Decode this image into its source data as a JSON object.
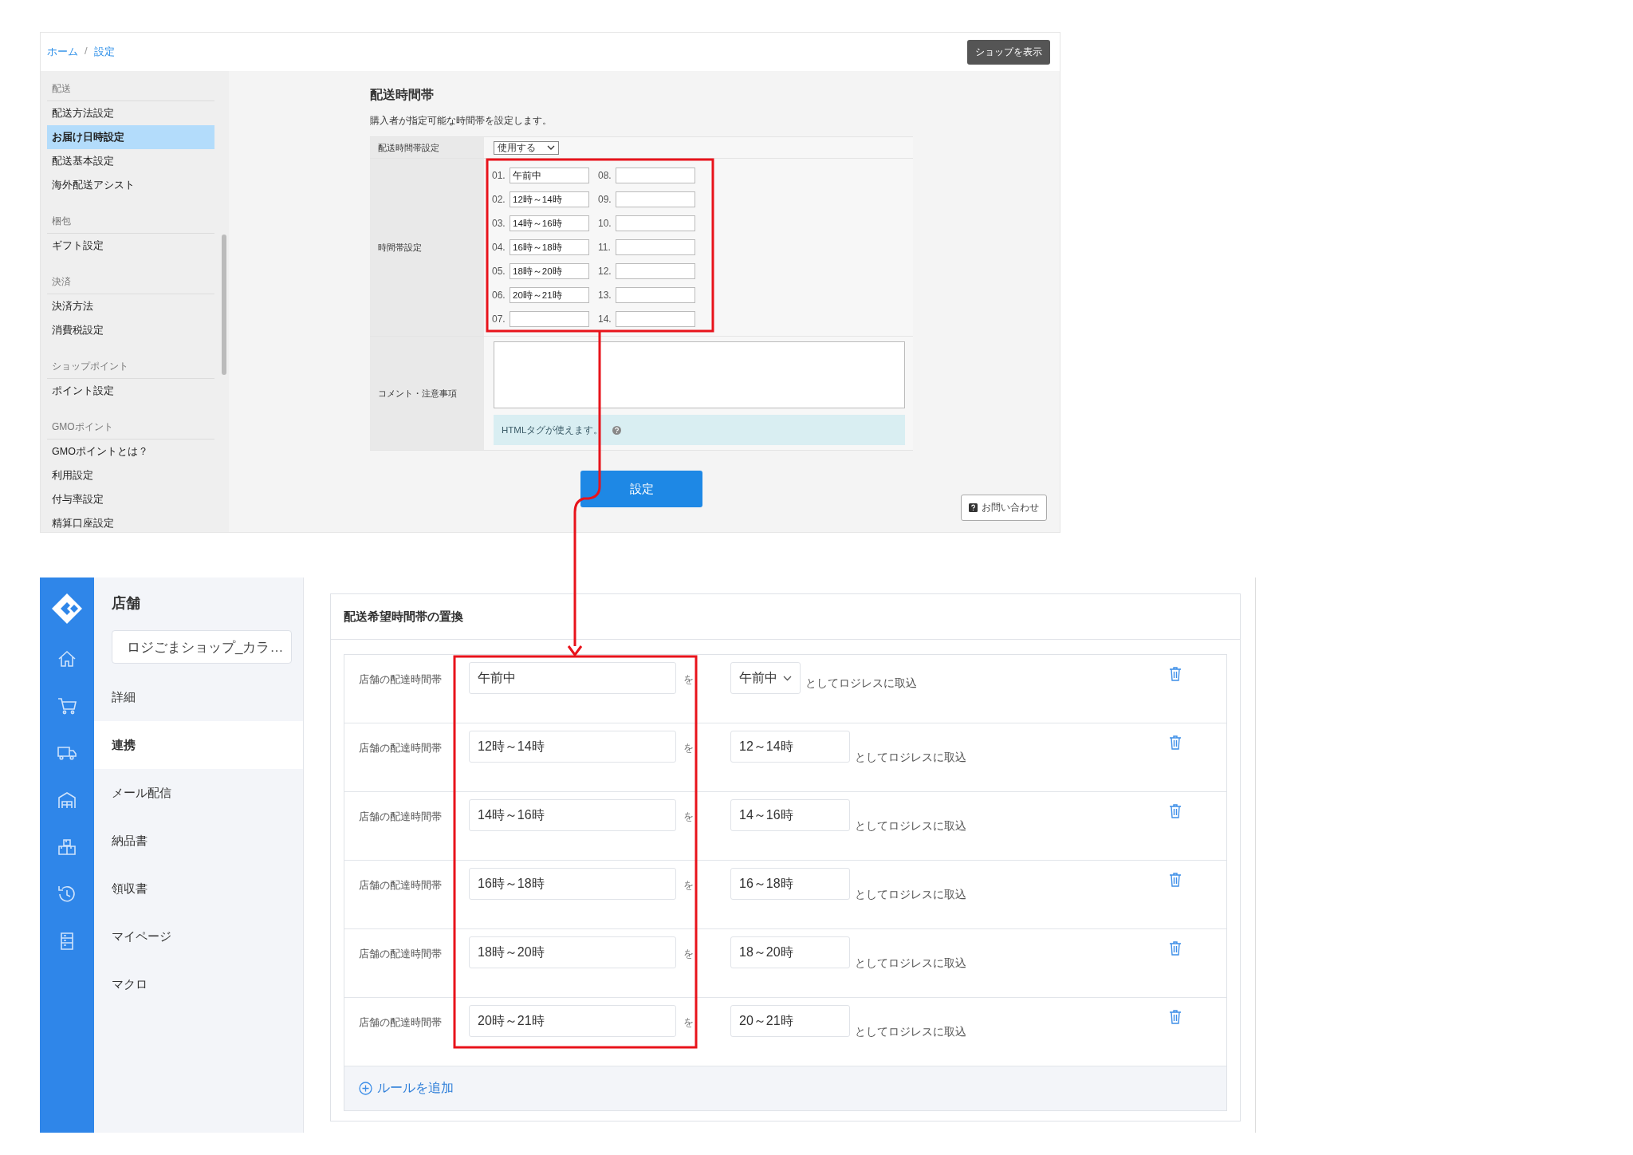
{
  "top_screen": {
    "breadcrumb": [
      "ホーム",
      "設定"
    ],
    "breadcrumb_separator": "/",
    "view_shop_button": "ショップを表示",
    "sidebar": [
      {
        "heading": "配送",
        "items": [
          {
            "label": "配送方法設定",
            "selected": false
          },
          {
            "label": "お届け日時設定",
            "selected": true
          },
          {
            "label": "配送基本設定",
            "selected": false
          },
          {
            "label": "海外配送アシスト",
            "selected": false
          }
        ]
      },
      {
        "heading": "梱包",
        "items": [
          {
            "label": "ギフト設定",
            "selected": false
          }
        ]
      },
      {
        "heading": "決済",
        "items": [
          {
            "label": "決済方法",
            "selected": false
          },
          {
            "label": "消費税設定",
            "selected": false
          }
        ]
      },
      {
        "heading": "ショップポイント",
        "items": [
          {
            "label": "ポイント設定",
            "selected": false
          }
        ]
      },
      {
        "heading": "GMOポイント",
        "items": [
          {
            "label": "GMOポイントとは？",
            "selected": false
          },
          {
            "label": "利用設定",
            "selected": false
          },
          {
            "label": "付与率設定",
            "selected": false
          },
          {
            "label": "精算口座設定",
            "selected": false
          }
        ]
      }
    ],
    "page_title": "配送時間帯",
    "description": "購入者が指定可能な時間帯を設定します。",
    "usage": {
      "label": "配送時間帯設定",
      "value": "使用する"
    },
    "time_slots": {
      "label": "時間帯設定",
      "slots": [
        {
          "number": "01.",
          "value": "午前中"
        },
        {
          "number": "02.",
          "value": "12時～14時"
        },
        {
          "number": "03.",
          "value": "14時～16時"
        },
        {
          "number": "04.",
          "value": "16時～18時"
        },
        {
          "number": "05.",
          "value": "18時～20時"
        },
        {
          "number": "06.",
          "value": "20時～21時"
        },
        {
          "number": "07."
        },
        {
          "number": "08."
        },
        {
          "number": "09."
        },
        {
          "number": "10."
        },
        {
          "number": "11."
        },
        {
          "number": "12."
        },
        {
          "number": "13."
        },
        {
          "number": "14."
        }
      ]
    },
    "comment": {
      "label": "コメント・注意事項",
      "hint": "HTMLタグが使えます。"
    },
    "submit_button": "設定",
    "contact_button": "お問い合わせ"
  },
  "bottom_screen": {
    "store_title": "店舗",
    "store_select": "ロジごまショップ_カラ…",
    "menu": [
      {
        "label": "詳細",
        "selected": false
      },
      {
        "label": "連携",
        "selected": true
      },
      {
        "label": "メール配信",
        "selected": false
      },
      {
        "label": "納品書",
        "selected": false
      },
      {
        "label": "領収書",
        "selected": false
      },
      {
        "label": "マイページ",
        "selected": false
      },
      {
        "label": "マクロ",
        "selected": false
      }
    ],
    "card_title": "配送希望時間帯の置換",
    "rules": [
      {
        "label": "店舗の配達時間帯",
        "source": "午前中",
        "particle": "を",
        "kind": "select",
        "target": "午前中",
        "suffix": "としてロジレスに取込"
      },
      {
        "label": "店舗の配達時間帯",
        "source": "12時～14時",
        "particle": "を",
        "kind": "input",
        "target": "12～14時",
        "suffix": "としてロジレスに取込"
      },
      {
        "label": "店舗の配達時間帯",
        "source": "14時～16時",
        "particle": "を",
        "kind": "input",
        "target": "14～16時",
        "suffix": "としてロジレスに取込"
      },
      {
        "label": "店舗の配達時間帯",
        "source": "16時～18時",
        "particle": "を",
        "kind": "input",
        "target": "16～18時",
        "suffix": "としてロジレスに取込"
      },
      {
        "label": "店舗の配達時間帯",
        "source": "18時～20時",
        "particle": "を",
        "kind": "input",
        "target": "18～20時",
        "suffix": "としてロジレスに取込"
      },
      {
        "label": "店舗の配達時間帯",
        "source": "20時～21時",
        "particle": "を",
        "kind": "input",
        "target": "20～21時",
        "suffix": "としてロジレスに取込"
      }
    ],
    "add_rule": "ルールを追加"
  }
}
